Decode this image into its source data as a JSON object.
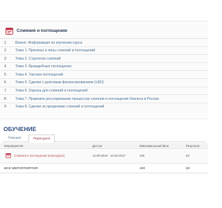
{
  "course": {
    "title": "Слияния и поглощения",
    "icon": "course-book-icon",
    "accent_color": "#c0394b",
    "items": [
      {
        "num": "1",
        "label": "Важно: Информация по изучению курса"
      },
      {
        "num": "2",
        "label": "Тема 1. Причины и типы слияний и поглощений"
      },
      {
        "num": "3",
        "label": "Тема 2. Стратегия слияний"
      },
      {
        "num": "4",
        "label": "Тема 3. Враждебные поглощения"
      },
      {
        "num": "5",
        "label": "Тема 4. Тактика поглощений"
      },
      {
        "num": "6",
        "label": "Тема 5. Сделки с долговым финансированием (LBO)"
      },
      {
        "num": "7",
        "label": "Тема 6. Оценка для слияний и поглощений"
      },
      {
        "num": "8",
        "label": "Тема 7. Правовое регулирование процессов слияния и поглощения бизнеса в России"
      },
      {
        "num": "9",
        "label": "Тема 8. Сделки за пределами слияний и поглощений"
      }
    ]
  },
  "learning": {
    "title": "ОБУЧЕНИЕ",
    "tabs": {
      "current": "Текущие",
      "archive": "Пересдача"
    },
    "columns": {
      "event": "Мероприятия",
      "access": "Доступ",
      "max_score": "Максимальный балл",
      "result": "Результат"
    },
    "rows": [
      {
        "event": "Слияния и поглощения (пересдача)",
        "access": "12.09.2016 - 12.03.2017",
        "max_score": "100",
        "result": "83",
        "icon": "course-book-icon"
      }
    ],
    "total": {
      "label": "ВСЕ МЕРОПРИЯТИЯ",
      "max_score": "100",
      "result": "83"
    }
  }
}
